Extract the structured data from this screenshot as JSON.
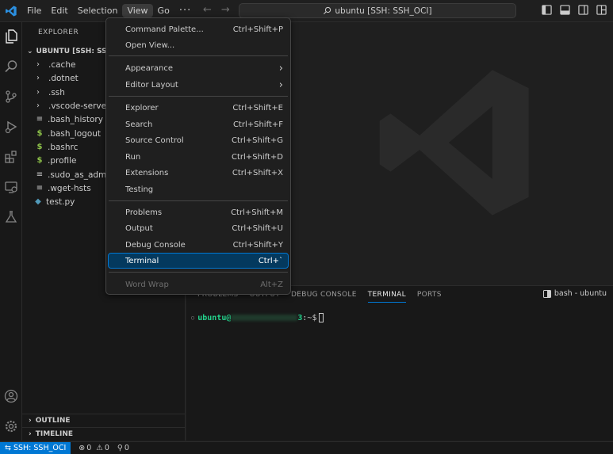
{
  "titlebar": {
    "menus": [
      "File",
      "Edit",
      "Selection",
      "View",
      "Go"
    ],
    "more": "···",
    "command_center": "ubuntu [SSH: SSH_OCI]"
  },
  "sidebar": {
    "title": "EXPLORER",
    "folder": "UBUNTU [SSH: SSH_OCI]",
    "items": [
      {
        "label": ".cache",
        "kind": "folder"
      },
      {
        "label": ".dotnet",
        "kind": "folder"
      },
      {
        "label": ".ssh",
        "kind": "folder"
      },
      {
        "label": ".vscode-server",
        "kind": "folder"
      },
      {
        "label": ".bash_history",
        "kind": "lines"
      },
      {
        "label": ".bash_logout",
        "kind": "dollar"
      },
      {
        "label": ".bashrc",
        "kind": "dollar"
      },
      {
        "label": ".profile",
        "kind": "dollar"
      },
      {
        "label": ".sudo_as_admin_successful",
        "kind": "lines"
      },
      {
        "label": ".wget-hsts",
        "kind": "lines"
      },
      {
        "label": "test.py",
        "kind": "python"
      }
    ],
    "outline": "OUTLINE",
    "timeline": "TIMELINE"
  },
  "view_menu": {
    "groups": [
      [
        {
          "label": "Command Palette...",
          "shortcut": "Ctrl+Shift+P"
        },
        {
          "label": "Open View...",
          "shortcut": ""
        }
      ],
      [
        {
          "label": "Appearance",
          "shortcut": "›"
        },
        {
          "label": "Editor Layout",
          "shortcut": "›"
        }
      ],
      [
        {
          "label": "Explorer",
          "shortcut": "Ctrl+Shift+E"
        },
        {
          "label": "Search",
          "shortcut": "Ctrl+Shift+F"
        },
        {
          "label": "Source Control",
          "shortcut": "Ctrl+Shift+G"
        },
        {
          "label": "Run",
          "shortcut": "Ctrl+Shift+D"
        },
        {
          "label": "Extensions",
          "shortcut": "Ctrl+Shift+X"
        },
        {
          "label": "Testing",
          "shortcut": ""
        }
      ],
      [
        {
          "label": "Problems",
          "shortcut": "Ctrl+Shift+M"
        },
        {
          "label": "Output",
          "shortcut": "Ctrl+Shift+U"
        },
        {
          "label": "Debug Console",
          "shortcut": "Ctrl+Shift+Y"
        },
        {
          "label": "Terminal",
          "shortcut": "Ctrl+`",
          "selected": true
        }
      ],
      [
        {
          "label": "Word Wrap",
          "shortcut": "Alt+Z",
          "disabled": true
        }
      ]
    ]
  },
  "panel": {
    "tabs": [
      "PROBLEMS",
      "OUTPUT",
      "DEBUG CONSOLE",
      "TERMINAL",
      "PORTS"
    ],
    "active_tab": "TERMINAL",
    "terminal_name": "bash - ubuntu",
    "prompt_user": "ubuntu@",
    "prompt_host_end": "3",
    "prompt_path": ":~$"
  },
  "statusbar": {
    "remote": "SSH: SSH_OCI",
    "errors": "0",
    "warnings": "0",
    "ports": "0"
  },
  "colors": {
    "accent": "#0078d4",
    "menu_selected": "#04395e",
    "terminal_green": "#23d18b"
  }
}
